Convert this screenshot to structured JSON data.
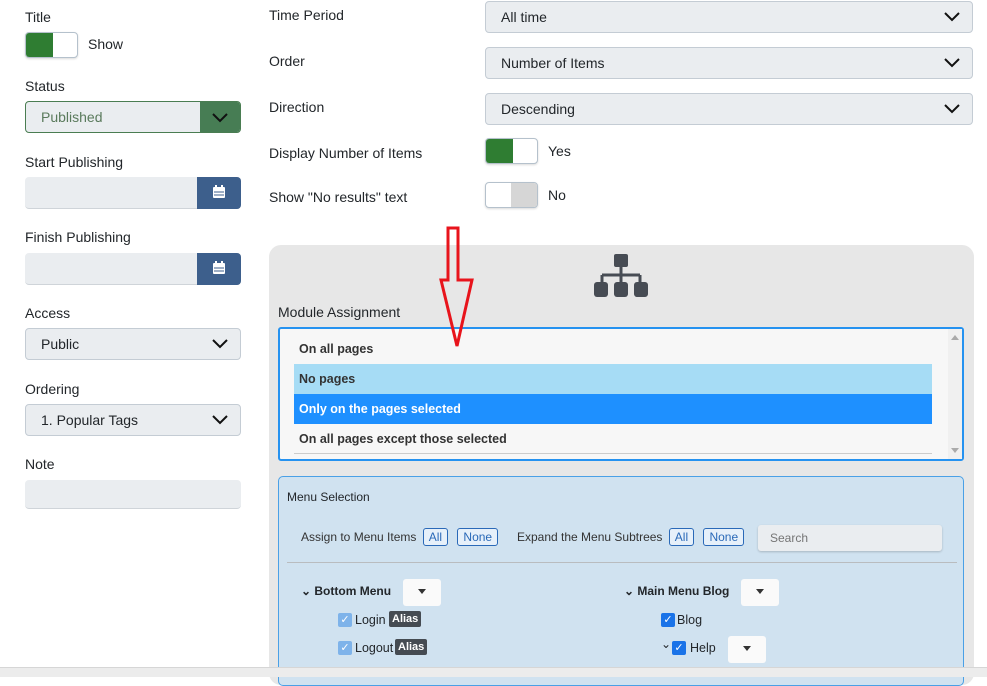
{
  "left": {
    "title": {
      "label": "Title",
      "toggle": "Show",
      "on": true
    },
    "status": {
      "label": "Status",
      "value": "Published"
    },
    "start_publishing": {
      "label": "Start Publishing",
      "value": ""
    },
    "finish_publishing": {
      "label": "Finish Publishing",
      "value": ""
    },
    "access": {
      "label": "Access",
      "value": "Public"
    },
    "ordering": {
      "label": "Ordering",
      "value": "1. Popular Tags"
    },
    "note": {
      "label": "Note",
      "value": ""
    }
  },
  "right": {
    "time_period": {
      "label": "Time Period",
      "value": "All time"
    },
    "order": {
      "label": "Order",
      "value": "Number of Items"
    },
    "direction": {
      "label": "Direction",
      "value": "Descending"
    },
    "display_number": {
      "label": "Display Number of Items",
      "toggle": "Yes",
      "on": true
    },
    "no_results": {
      "label": "Show \"No results\" text",
      "toggle": "No",
      "on": false
    }
  },
  "assignment": {
    "icon": "sitemap-icon",
    "label": "Module Assignment",
    "options": [
      "On all pages",
      "No pages",
      "Only on the pages selected",
      "On all pages except those selected"
    ],
    "selected": "Only on the pages selected",
    "hovered": "No pages"
  },
  "menu_selection": {
    "title": "Menu Selection",
    "assign_label": "Assign to Menu Items",
    "all": "All",
    "none": "None",
    "expand_label": "Expand the Menu Subtrees",
    "search_placeholder": "Search",
    "menus": [
      {
        "name": "Bottom Menu",
        "items": [
          {
            "label": "Login",
            "badge": "Alias"
          },
          {
            "label": "Logout",
            "badge": "Alias"
          }
        ]
      },
      {
        "name": "Main Menu Blog",
        "items": [
          {
            "label": "Blog"
          },
          {
            "label": "Help"
          }
        ]
      }
    ]
  },
  "colors": {
    "green": "#2f7d32",
    "blue_button": "#3d5f8c",
    "selected": "#1e90ff",
    "hover": "#a6dcf5",
    "annotation_arrow": "#e8141c"
  }
}
